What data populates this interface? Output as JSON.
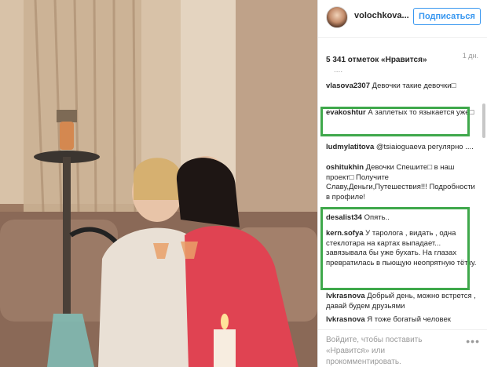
{
  "header": {
    "username": "volochkova...",
    "follow_label": "Подписаться"
  },
  "post": {
    "likes": "5 341 отметок «Нравится»",
    "time": "1 дн.",
    "ellipsis": "...."
  },
  "comments": [
    {
      "user": "vlasova2307",
      "text": "Девочки такие девочки□"
    },
    {
      "user": "evakoshtur",
      "text": "А заплетых то языкается уже□"
    },
    {
      "user": "ludmylatitova",
      "text": "@tsiaioguaeva регулярно ...."
    },
    {
      "user": "oshitukhin",
      "text": "Девочки Спешите□ в наш проект□ Получите Славу,Деньги,Путешествия!!! Подробности в профиле!"
    },
    {
      "user": "desalist34",
      "text": "Опять.."
    },
    {
      "user": "kern.sofya",
      "text": "У таролога , видать , одна стеклотара на картах выпадает... завязывала бы уже бухать. На глазах превратилась в пьющую неопрятную тётку."
    },
    {
      "user": "lvkrasnova",
      "text": "Добрый день, можно встрется , давай будем друзьями"
    },
    {
      "user": "lvkrasnova",
      "text": "Я тоже богатый человек"
    }
  ],
  "footer": {
    "prompt": "Войдите, чтобы поставить «Нравится» или прокомментировать.",
    "more_icon": "•••"
  },
  "colors": {
    "accent": "#3897f0",
    "highlight": "#3fa84b"
  }
}
